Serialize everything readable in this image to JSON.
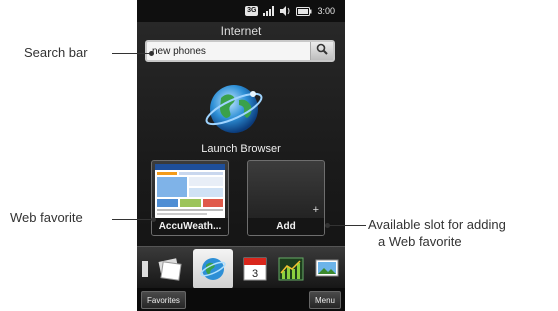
{
  "phone": {
    "status_bar": {
      "network_badge": "3G",
      "time": "3:00"
    },
    "title": "Internet",
    "search": {
      "value": "new phones"
    },
    "launch_label": "Launch Browser",
    "favorites": [
      {
        "caption": "AccuWeath..."
      },
      {
        "caption": "Add"
      }
    ],
    "softkeys": {
      "left": "Favorites",
      "right": "Menu"
    },
    "dock_icons": [
      "photos-icon",
      "internet-icon",
      "calendar-icon",
      "stocks-icon",
      "album-icon"
    ]
  },
  "callouts": {
    "search_bar": "Search bar",
    "web_favorite": "Web favorite",
    "available_slot_line1": "Available slot for adding",
    "available_slot_line2": "a Web favorite"
  },
  "colors": {
    "screen_bg": "#1b1b1b",
    "accent_globe": "#2d8fd6",
    "text_light": "#f0f0f0",
    "callout_text": "#333333"
  }
}
